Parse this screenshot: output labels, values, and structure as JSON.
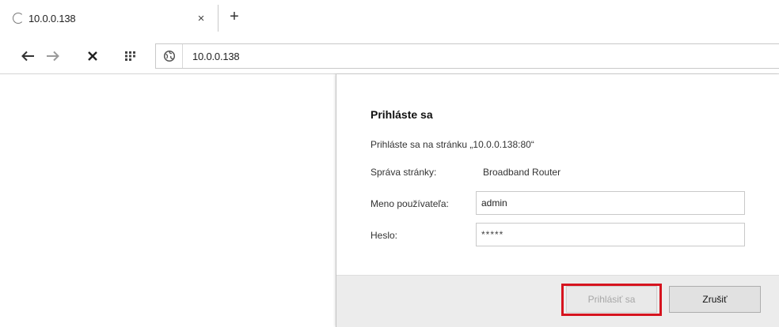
{
  "tab": {
    "title": "10.0.0.138",
    "close_glyph": "×",
    "new_tab_glyph": "+"
  },
  "toolbar": {
    "address": "10.0.0.138",
    "icons": [
      "back-arrow-icon",
      "forward-arrow-icon",
      "stop-icon",
      "apps-grid-icon",
      "site-info-icon"
    ]
  },
  "dialog": {
    "title": "Prihláste sa",
    "description": "Prihláste sa na stránku „10.0.0.138:80“",
    "realm_label": "Správa stránky:",
    "realm_value": "Broadband Router",
    "username_label": "Meno používateľa:",
    "username_value": "admin",
    "password_label": "Heslo:",
    "password_value": "*****",
    "login_button": "Prihlásiť sa",
    "cancel_button": "Zrušiť"
  },
  "colors": {
    "highlight": "#d6141f",
    "footer_bg": "#ececec",
    "disabled_text": "#a7a7a7"
  }
}
